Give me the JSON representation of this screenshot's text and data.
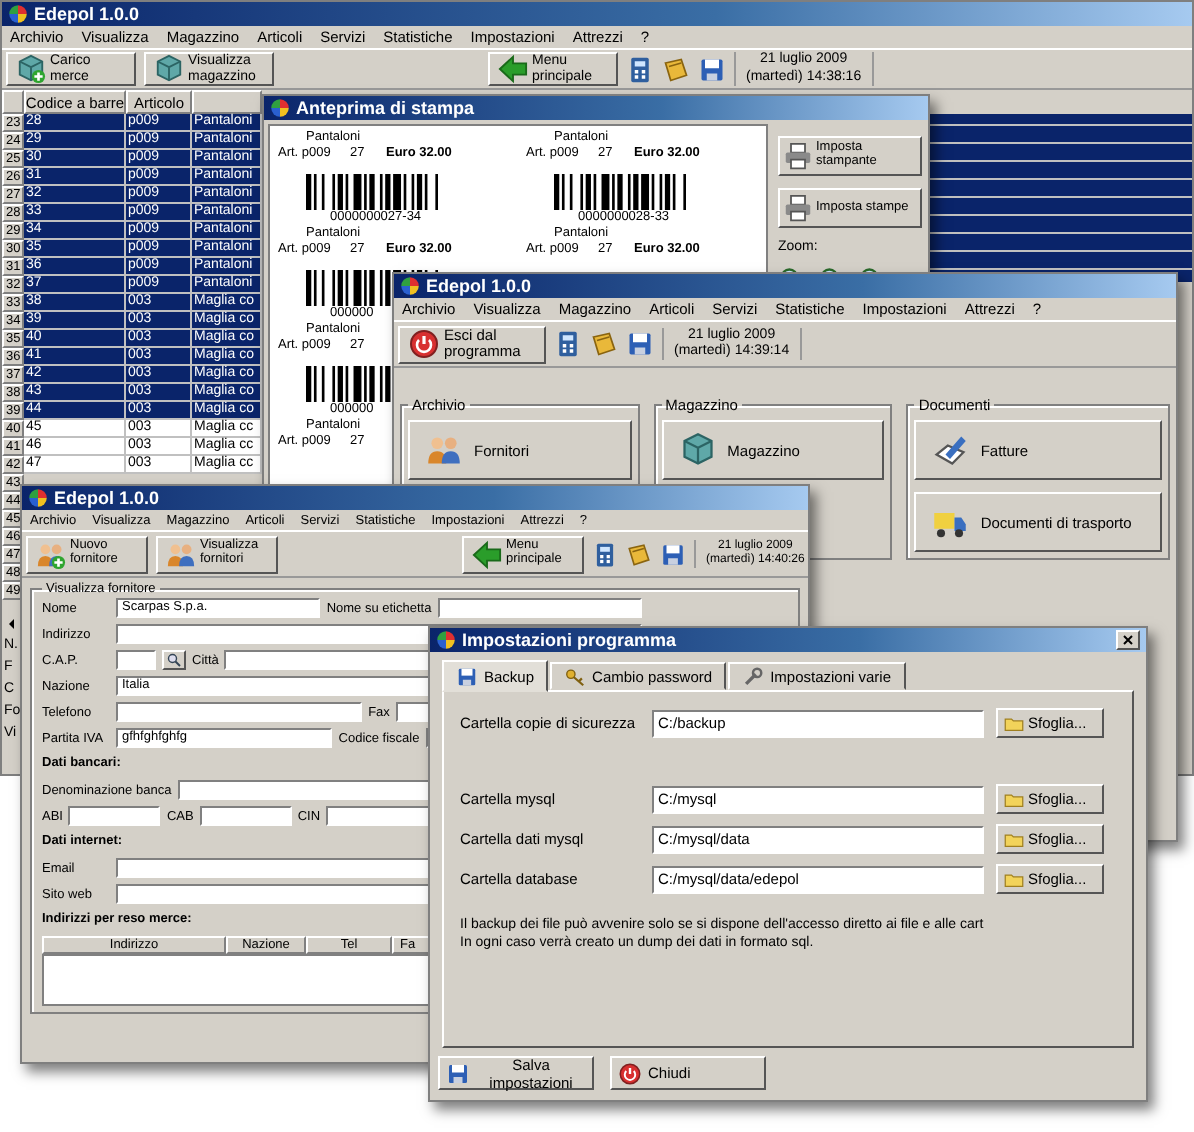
{
  "main_window": {
    "title": "Edepol 1.0.0",
    "menu": [
      "Archivio",
      "Visualizza",
      "Magazzino",
      "Articoli",
      "Servizi",
      "Statistiche",
      "Impostazioni",
      "Attrezzi",
      "?"
    ],
    "toolbar": [
      {
        "kind": "stock",
        "label": "Carico merce"
      },
      {
        "kind": "warehouse",
        "label": "Visualizza magazzino"
      },
      {
        "kind": "home",
        "label": "Menu principale"
      }
    ],
    "date": "21 luglio 2009",
    "time": "(martedì) 14:38:16",
    "table": {
      "columns": [
        "Codice a barre",
        "Articolo"
      ],
      "rows": [
        {
          "number": "23",
          "code": "28",
          "article": "p009",
          "description": "Pantaloni",
          "selected": true
        },
        {
          "number": "24",
          "code": "29",
          "article": "p009",
          "description": "Pantaloni",
          "selected": true
        },
        {
          "number": "25",
          "code": "30",
          "article": "p009",
          "description": "Pantaloni",
          "selected": true
        },
        {
          "number": "26",
          "code": "31",
          "article": "p009",
          "description": "Pantaloni",
          "selected": true
        },
        {
          "number": "27",
          "code": "32",
          "article": "p009",
          "description": "Pantaloni",
          "selected": true
        },
        {
          "number": "28",
          "code": "33",
          "article": "p009",
          "description": "Pantaloni",
          "selected": true
        },
        {
          "number": "29",
          "code": "34",
          "article": "p009",
          "description": "Pantaloni",
          "selected": true
        },
        {
          "number": "30",
          "code": "35",
          "article": "p009",
          "description": "Pantaloni",
          "selected": true
        },
        {
          "number": "31",
          "code": "36",
          "article": "p009",
          "description": "Pantaloni",
          "selected": true
        },
        {
          "number": "32",
          "code": "37",
          "article": "p009",
          "description": "Pantaloni",
          "selected": true
        },
        {
          "number": "33",
          "code": "38",
          "article": "003",
          "description": "Maglia co",
          "selected": true
        },
        {
          "number": "34",
          "code": "39",
          "article": "003",
          "description": "Maglia co",
          "selected": true
        },
        {
          "number": "35",
          "code": "40",
          "article": "003",
          "description": "Maglia co",
          "selected": true
        },
        {
          "number": "36",
          "code": "41",
          "article": "003",
          "description": "Maglia co",
          "selected": true
        },
        {
          "number": "37",
          "code": "42",
          "article": "003",
          "description": "Maglia co",
          "selected": true
        },
        {
          "number": "38",
          "code": "43",
          "article": "003",
          "description": "Maglia co",
          "selected": true
        },
        {
          "number": "39",
          "code": "44",
          "article": "003",
          "description": "Maglia co",
          "selected": true
        },
        {
          "number": "40",
          "code": "45",
          "article": "003",
          "description": "Maglia cc",
          "selected": false
        },
        {
          "number": "41",
          "code": "46",
          "article": "003",
          "description": "Maglia cc",
          "selected": false
        },
        {
          "number": "42",
          "code": "47",
          "article": "003",
          "description": "Maglia cc",
          "selected": false
        }
      ],
      "row_numbers_below": [
        "43",
        "44",
        "45",
        "46",
        "47",
        "48",
        "49"
      ]
    },
    "footer_fragments": [
      "N.",
      "F",
      "C",
      "Fo",
      "Vi"
    ]
  },
  "preview_window": {
    "title": "Anteprima di stampa",
    "label_rows": [
      [
        {
          "name": "Pantaloni",
          "article": "Art. p009",
          "qty": "27",
          "price": "Euro 32.00"
        },
        {
          "name": "Pantaloni",
          "article": "Art. p009",
          "qty": "27",
          "price": "Euro 32.00"
        }
      ],
      [
        {
          "code": "0000000027-34",
          "name": "Pantaloni",
          "article": "Art. p009",
          "qty": "27",
          "price": "Euro 32.00"
        },
        {
          "code": "0000000028-33",
          "name": "Pantaloni",
          "article": "Art. p009",
          "qty": "27",
          "price": "Euro 32.00"
        }
      ],
      [
        {
          "code": "000000",
          "name": "Pantaloni",
          "article": "Art. p009",
          "qty": "27"
        }
      ],
      [
        {
          "code": "000000",
          "name": "Pantaloni",
          "article": "Art. p009",
          "qty": "27"
        }
      ]
    ],
    "buttons": [
      "Imposta stampante",
      "Imposta stampe"
    ],
    "zoom_label": "Zoom:"
  },
  "menu_window": {
    "title": "Edepol 1.0.0",
    "menu": [
      "Archivio",
      "Visualizza",
      "Magazzino",
      "Articoli",
      "Servizi",
      "Statistiche",
      "Impostazioni",
      "Attrezzi",
      "?"
    ],
    "exit_button": "Esci dal programma",
    "date": "21 luglio 2009",
    "time": "(martedì) 14:39:14",
    "groups": [
      {
        "title": "Archivio",
        "buttons": [
          {
            "kind": "suppliers",
            "label": "Fornitori"
          }
        ]
      },
      {
        "title": "Magazzino",
        "buttons": [
          {
            "kind": "warehouse",
            "label": "Magazzino"
          }
        ]
      },
      {
        "title": "Documenti",
        "buttons": [
          {
            "kind": "invoice",
            "label": "Fatture"
          },
          {
            "kind": "truck",
            "label": "Documenti di trasporto"
          }
        ]
      }
    ]
  },
  "supplier_window": {
    "title": "Edepol 1.0.0",
    "menu": [
      "Archivio",
      "Visualizza",
      "Magazzino",
      "Articoli",
      "Servizi",
      "Statistiche",
      "Impostazioni",
      "Attrezzi",
      "?"
    ],
    "toolbar": [
      {
        "kind": "new-supplier",
        "label": "Nuovo fornitore"
      },
      {
        "kind": "suppliers",
        "label": "Visualizza fornitori"
      },
      {
        "kind": "home",
        "label": "Menu principale"
      }
    ],
    "date": "21 luglio 2009",
    "time": "(martedì) 14:40:26",
    "group_title": "Visualizza fornitore",
    "form_rows": [
      {
        "kind": "fields",
        "items": [
          {
            "kind": "text",
            "label": "Nome",
            "value": "Scarpas S.p.a."
          },
          {
            "kind": "text",
            "label": "Nome su etichetta"
          }
        ]
      },
      {
        "kind": "fields",
        "items": [
          {
            "kind": "text",
            "label": "Indirizzo"
          }
        ]
      },
      {
        "kind": "fields",
        "items": [
          {
            "kind": "lookup",
            "label": "C.A.P."
          },
          {
            "kind": "text",
            "label": "Città"
          }
        ]
      },
      {
        "kind": "fields",
        "items": [
          {
            "kind": "text",
            "label": "Nazione",
            "value": "Italia"
          }
        ]
      },
      {
        "kind": "fields",
        "items": [
          {
            "kind": "text",
            "label": "Telefono"
          },
          {
            "kind": "text",
            "label": "Fax"
          }
        ]
      },
      {
        "kind": "fields",
        "items": [
          {
            "kind": "text",
            "label": "Partita IVA",
            "value": "gfhfghfghfg"
          },
          {
            "kind": "text",
            "label": "Codice fiscale"
          }
        ]
      },
      {
        "kind": "heading",
        "text": "Dati bancari:"
      },
      {
        "kind": "fields",
        "items": [
          {
            "kind": "text",
            "label": "Denominazione banca"
          }
        ]
      },
      {
        "kind": "fields",
        "items": [
          {
            "kind": "text",
            "label": "ABI"
          },
          {
            "kind": "text",
            "label": "CAB"
          },
          {
            "kind": "text",
            "label": "CIN"
          }
        ]
      },
      {
        "kind": "heading",
        "text": "Dati internet:"
      },
      {
        "kind": "fields",
        "items": [
          {
            "kind": "text",
            "label": "Email"
          }
        ]
      },
      {
        "kind": "fields",
        "items": [
          {
            "kind": "text",
            "label": "Sito web"
          }
        ]
      },
      {
        "kind": "heading",
        "text": "Indirizzi per reso merce:"
      }
    ],
    "return_table": {
      "columns": [
        "Indirizzo",
        "Nazione",
        "Tel",
        "Fa"
      ]
    }
  },
  "settings_dialog": {
    "title": "Impostazioni programma",
    "tabs": [
      {
        "kind": "backup",
        "label": "Backup",
        "selected": true
      },
      {
        "kind": "password",
        "label": "Cambio password",
        "selected": false
      },
      {
        "kind": "misc",
        "label": "Impostazioni varie",
        "selected": false
      }
    ],
    "rows": [
      {
        "label": "Cartella copie di sicurezza",
        "value": "C:/backup",
        "button": "Sfoglia..."
      },
      {
        "label": "Cartella mysql",
        "value": "C:/mysql",
        "button": "Sfoglia..."
      },
      {
        "label": "Cartella dati mysql",
        "value": "C:/mysql/data",
        "button": "Sfoglia..."
      },
      {
        "label": "Cartella database",
        "value": "C:/mysql/data/edepol",
        "button": "Sfoglia..."
      }
    ],
    "note": [
      "Il backup dei file può avvenire solo se si dispone dell'accesso diretto ai file e alle cart",
      "In ogni caso verrà creato un dump dei dati in formato sql."
    ],
    "buttons": [
      {
        "kind": "save",
        "label": "Salva impostazioni"
      },
      {
        "kind": "close",
        "label": "Chiudi"
      }
    ]
  }
}
